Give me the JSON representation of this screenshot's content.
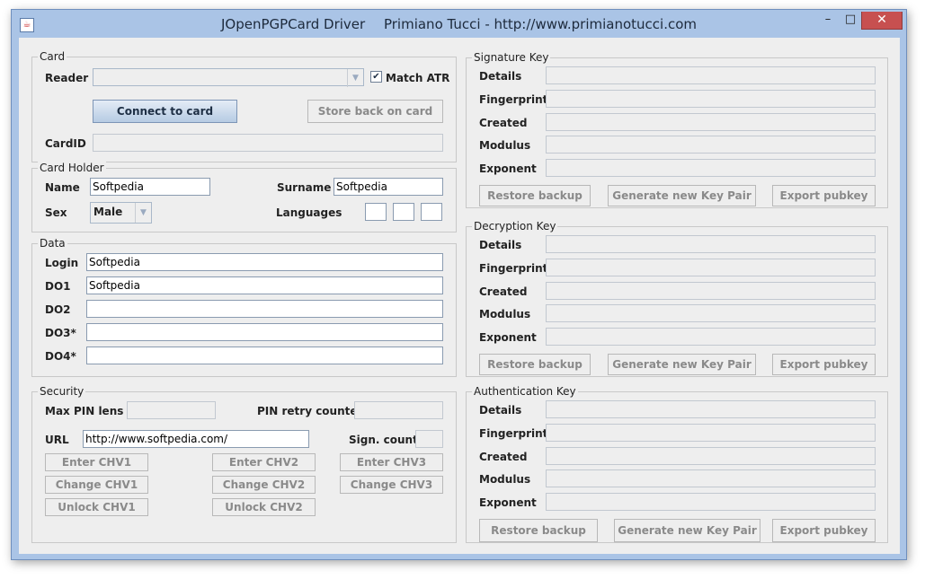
{
  "window": {
    "title_app": "JOpenPGPCard Driver",
    "title_author": "Primiano Tucci - http://www.primianotucci.com",
    "minimize_label": "–",
    "maximize_label": "□",
    "close_label": "✕"
  },
  "card": {
    "legend": "Card",
    "reader_label": "Reader",
    "reader_value": "",
    "match_atr_label": "Match ATR",
    "match_atr_checked": "✔",
    "connect_button": "Connect to card",
    "store_button": "Store back on card",
    "cardid_label": "CardID",
    "cardid_value": ""
  },
  "card_holder": {
    "legend": "Card Holder",
    "name_label": "Name",
    "name_value": "Softpedia",
    "surname_label": "Surname",
    "surname_value": "Softpedia",
    "sex_label": "Sex",
    "sex_value": "Male",
    "languages_label": "Languages"
  },
  "data": {
    "legend": "Data",
    "fields": [
      {
        "label": "Login",
        "value": "Softpedia"
      },
      {
        "label": "DO1",
        "value": "Softpedia"
      },
      {
        "label": "DO2",
        "value": ""
      },
      {
        "label": "DO3*",
        "value": ""
      },
      {
        "label": "DO4*",
        "value": ""
      }
    ]
  },
  "security": {
    "legend": "Security",
    "max_pin_label": "Max PIN lens",
    "pin_retry_label": "PIN retry counter",
    "url_label": "URL",
    "url_value": "http://www.softpedia.com/",
    "sign_count_label": "Sign. count",
    "buttons": {
      "enter_chv1": "Enter CHV1",
      "enter_chv2": "Enter CHV2",
      "enter_chv3": "Enter CHV3",
      "change_chv1": "Change CHV1",
      "change_chv2": "Change CHV2",
      "change_chv3": "Change CHV3",
      "unlock_chv1": "Unlock CHV1",
      "unlock_chv2": "Unlock CHV2"
    }
  },
  "keys": [
    {
      "legend": "Signature Key",
      "labels": [
        "Details",
        "Fingerprint",
        "Created",
        "Modulus",
        "Exponent"
      ],
      "restore": "Restore backup",
      "generate": "Generate new Key Pair",
      "export": "Export pubkey"
    },
    {
      "legend": "Decryption Key",
      "labels": [
        "Details",
        "Fingerprint",
        "Created",
        "Modulus",
        "Exponent"
      ],
      "restore": "Restore  backup",
      "generate": "Generate new Key Pair",
      "export": "Export pubkey"
    },
    {
      "legend": "Authentication Key",
      "labels": [
        "Details",
        "Fingerprint",
        "Created",
        "Modulus",
        "Exponent"
      ],
      "restore": "Restore backup",
      "generate": "Generate new Key Pair",
      "export": "Export pubkey"
    }
  ],
  "colors": {
    "titlebar": "#aac4e6",
    "close_button": "#c75050",
    "panel": "#eeeeee"
  }
}
